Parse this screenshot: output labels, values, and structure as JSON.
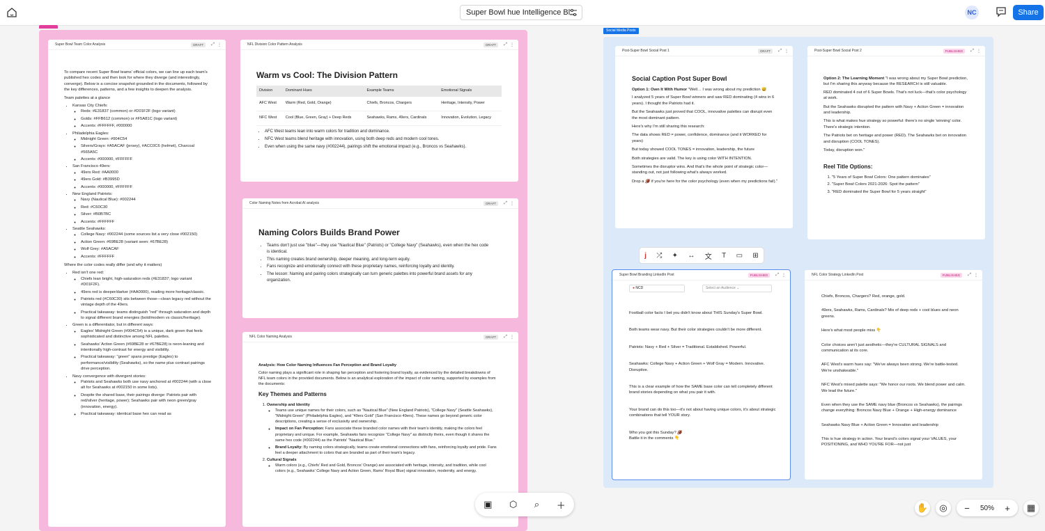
{
  "header": {
    "title": "Super Bowl hue Intelligence Bl...",
    "avatar": "NC",
    "share": "Share"
  },
  "groups": {
    "social_label": "Social Media Posts"
  },
  "cards": {
    "c1": {
      "title": "Super Bowl Team Color Analysis",
      "badge": "DRAFT",
      "intro": "To compare recent Super Bowl teams' official colors, we can line up each team's published hex codes and then look for where they diverge (and interestingly, converge). Below is a concise snapshot grounded in the documents, followed by the key differences, patterns, and a few insights to deepen the analysis.",
      "glance": "Team palettes at a glance",
      "teams": [
        {
          "name": "Kansas City Chiefs:",
          "items": [
            "Reds: #E31837 (common) or #D01F2F (logo variant)",
            "Golds: #FFB612 (common) or #F5A81C (logo variant)",
            "Accents: #FFFFFF, #000000"
          ]
        },
        {
          "name": "Philadelphia Eagles:",
          "items": [
            "Midnight Green: #004C54",
            "Silvers/Grays: #A5ACAF (jersey), #ACC0C6 (helmet), Charcoal #565A5C",
            "Accents: #000000, #FFFFFF"
          ]
        },
        {
          "name": "San Francisco 49ers:",
          "items": [
            "49ers Red: #AA0000",
            "49ers Gold: #B3995D",
            "Accents: #000000, #FFFFFF"
          ]
        },
        {
          "name": "New England Patriots:",
          "items": [
            "Navy (Nautical Blue): #002244",
            "Red: #C60C30",
            "Silver: #B0B7BC",
            "Accents: #FFFFFF"
          ]
        },
        {
          "name": "Seattle Seahawks:",
          "items": [
            "College Navy: #002244 (some sources list a very close #002150)",
            "Action Green: #69BE28 (variant seen: #67BE28)",
            "Wolf Grey: #A5ACAF",
            "Accents: #FFFFFF"
          ]
        }
      ],
      "differ": "Where the color codes really differ (and why it matters)",
      "diffs": [
        {
          "name": "Red isn't one red:",
          "items": [
            "Chiefs lean bright, high-saturation reds (#E31837; logo variant #D01F2F).",
            "49ers red is deeper/darker (#AA0000), reading more heritage/classic.",
            "Patriots red (#C60C30) sits between those—clean legacy red without the vintage depth of the 49ers.",
            "Practical takeaway: teams distinguish \"red\" through saturation and depth to signal different brand energies (bold/modern vs classic/heritage)."
          ]
        },
        {
          "name": "Green is a differentiator, but in different ways:",
          "items": [
            "Eagles' Midnight Green (#004C54) is a unique, dark green that feels sophisticated and distinctive among NFL palettes.",
            "Seahawks' Action Green (#69BE28 or #67BE28) is neon-leaning and intentionally high-contrast for energy and visibility.",
            "Practical takeaway: \"green\" spans prestige (Eagles) to performance/visibility (Seahawks), so the name plus contrast pairings drive perception."
          ]
        },
        {
          "name": "Navy convergence with divergent stories:",
          "items": [
            "Patriots and Seahawks both use navy anchored at #002244 (with a close alt for Seahawks at #002150 in some lists).",
            "Despite the shared base, their pairings diverge: Patriots pair with red/silver (heritage, power); Seahawks pair with neon green/gray (innovation, energy).",
            "Practical takeaway: identical base hex can read as"
          ]
        }
      ]
    },
    "c2": {
      "title": "NFL Division Color Pattern Analysis",
      "badge": "DRAFT",
      "heading": "Warm vs Cool: The Division Pattern",
      "headers": [
        "Division",
        "Dominant Hues",
        "Example Teams",
        "Emotional Signals"
      ],
      "rows": [
        [
          "AFC West",
          "Warm (Red, Gold, Orange)",
          "Chiefs, Broncos, Chargers",
          "Heritage, Intensity, Power"
        ],
        [
          "NFC West",
          "Cool (Blue, Green, Gray) + Deep Reds",
          "Seahawks, Rams, 49ers, Cardinals",
          "Innovation, Evolution, Legacy"
        ]
      ],
      "bullets": [
        "AFC West teams lean into warm colors for tradition and dominance.",
        "NFC West teams blend heritage with innovation, using both deep reds and modern cool tones.",
        "Even when using the same navy (#002244), pairings shift the emotional impact (e.g., Broncos vs Seahawks)."
      ]
    },
    "c3": {
      "title": "Color Naming Notes from Acrobat AI analysis",
      "badge": "DRAFT",
      "heading": "Naming Colors Builds Brand Power",
      "bullets": [
        "Teams don't just use \"blue\"—they use \"Nautical Blue\" (Patriots) or \"College Navy\" (Seahawks), even when the hex code is identical.",
        "This naming creates brand ownership, deeper meaning, and long-term equity.",
        "Fans recognize and emotionally connect with these proprietary names, reinforcing loyalty and identity.",
        "The lesson: Naming and pairing colors strategically can turn generic palettes into powerful brand assets for any organization."
      ]
    },
    "c4": {
      "title": "NFL Color Naming Analysis",
      "badge": "DRAFT",
      "subhead": "Analysis: How Color Naming Influences Fan Perception and Brand Loyalty",
      "intro": "Color naming plays a significant role in shaping fan perception and fostering brand loyalty, as evidenced by the detailed breakdowns of NFL team colors in the provided documents. Below is an analytical exploration of the impact of color naming, supported by examples from the documents:",
      "heading": "Key Themes and Patterns",
      "s1": "Ownership and Identity",
      "s1a": "Teams use unique names for their colors, such as \"Nautical Blue\" (New England Patriots), \"College Navy\" (Seattle Seahawks), \"Midnight Green\" (Philadelphia Eagles), and \"49ers Gold\" (San Francisco 49ers). These names go beyond generic color descriptions, creating a sense of exclusivity and ownership.",
      "s1b_l": "Impact on Fan Perception:",
      "s1b": " Fans associate these branded color names with their team's identity, making the colors feel proprietary and unique. For example, Seahawks fans recognize \"College Navy\" as distinctly theirs, even though it shares the same hex code (#002244) as the Patriots' \"Nautical Blue.\"",
      "s1c_l": "Brand Loyalty:",
      "s1c": " By naming colors strategically, teams create emotional connections with fans, reinforcing loyalty and pride. Fans feel a deeper attachment to colors that are branded as part of their team's legacy.",
      "s2": "Cultural Signals",
      "s2a": "Warm colors (e.g., Chiefs' Red and Gold, Broncos' Orange) are associated with heritage, intensity, and tradition, while cool colors (e.g., Seahawks' College Navy and Action Green, Rams' Royal Blue) signal innovation, modernity, and energy."
    },
    "p1": {
      "title": "Post-Super Bowl Social Post 1",
      "badge": "DRAFT",
      "heading": "Social Caption Post Super Bowl",
      "opt_l": "Option 1: Own It With Humor",
      "opt": " \"Well… I was wrong about my prediction 😅",
      "paras": [
        "I analyzed 5 years of Super Bowl winners and saw RED dominating (4 wins in 6 years). I thought the Patriots had it.",
        "But the Seahawks just proved that COOL, innovative palettes can disrupt even the most dominant pattern.",
        "Here's why I'm still sharing this research:",
        "The data shows RED = power, confidence, dominance (and it WORKED for years)",
        "But today showed COOL TONES = innovation, leadership, the future",
        "Both strategies are valid. The key is using color WITH INTENTION.",
        "Sometimes the disruptor wins. And that's the whole point of strategic color—standing out, not just following what's always worked.",
        "Drop a 🏈 if you're here for the color psychology (even when my predictions fail).\""
      ]
    },
    "p2": {
      "title": "Post-Super Bowl Social Post 2",
      "badge": "PUBLISHED",
      "opt_l": "Option 2: The Learning Moment",
      "opt": " \"I was wrong about my Super Bowl prediction, but I'm sharing this anyway because the RESEARCH is still valuable.",
      "paras": [
        "RED dominated 4 out of 6 Super Bowls. That's not luck—that's color psychology at work.",
        "But the Seahawks disrupted the pattern with Navy + Action Green = innovation and leadership.",
        "This is what makes hue strategy so powerful: there's no single 'winning' color. There's strategic intention.",
        "The Patriots bet on heritage and power (RED). The Seahawks bet on innovation and disruption (COOL TONES).",
        "Today, disruption won.\""
      ],
      "reel": "Reel Title Options:",
      "reels": [
        "\"5 Years of Super Bowl Colors: One pattern dominates\"",
        "\"Super Bowl Colors 2021-2026: Spot the pattern\"",
        "\"RED dominated the Super Bowl for 5 years straight\""
      ]
    },
    "p3": {
      "title": "Super Bowl Branding LinkedIn Post",
      "badge": "PUBLISHED",
      "account": "NCD",
      "audience": "Select an Audience",
      "paras": [
        "Football color facts I bet you didn't know about THIS Sunday's Super Bowl.",
        "Both teams wear navy. But their color strategies couldn't be more different.",
        "Patriots: Navy + Red + Silver = Traditional. Established. Powerful.",
        "Seahawks: College Navy + Action Green + Wolf Gray = Modern. Innovative. Disruptive.",
        "This is a clear example of how the SAME base color can tell completely different brand stories depending on what you pair it with.",
        "Your brand can do this too—it's not about having unique colors, it's about strategic combinations that tell YOUR story.",
        "Who you got this Sunday? 🏈\nBattle it in the comments 👇"
      ]
    },
    "p4": {
      "title": "NFL Color Strategy LinkedIn Post",
      "badge": "PUBLISHED",
      "paras": [
        "Chiefs, Broncos, Chargers? Red, orange, gold.",
        "49ers, Seahawks, Rams, Cardinals? Mix of deep reds + cool blues and neon greens.",
        "Here's what most people miss 👇",
        "Color choices aren't just aesthetic—they're CULTURAL SIGNALS and communication at its core.",
        "AFC West's warm hues say: \"We've always been strong. We're battle-tested. We're unshakeable.\"",
        "NFC West's mixed palette says: \"We honor our roots. We blend power and calm. We lead the future.\"",
        "Even when they use the SAME navy blue (Broncos vs Seahawks), the pairings change everything: Broncos Navy Blue + Orange + High-energy dominance",
        "Seahawks Navy Blue + Action Green = Innovation and leadership",
        "This is hue strategy in action. Your brand's colors signal your VALUES, your POSITIONING, and WHO YOU'RE FOR—not just"
      ]
    }
  },
  "zoom": "50%"
}
